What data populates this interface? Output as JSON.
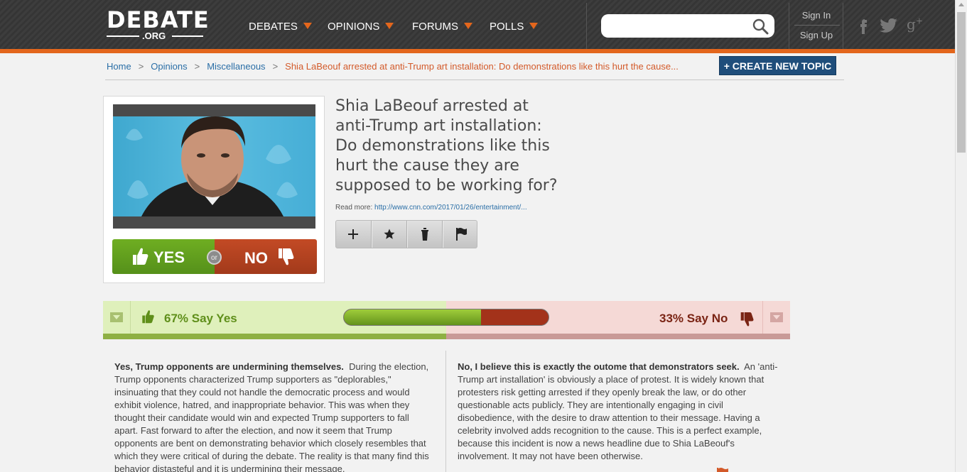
{
  "header": {
    "logo_main": "DEBATE",
    "logo_sub": ".ORG",
    "nav": [
      {
        "label": "DEBATES"
      },
      {
        "label": "OPINIONS"
      },
      {
        "label": "FORUMS"
      },
      {
        "label": "POLLS"
      }
    ],
    "search_placeholder": "",
    "sign_in": "Sign In",
    "sign_up": "Sign Up",
    "social": [
      "facebook-icon",
      "twitter-icon",
      "google-plus-icon"
    ],
    "accent_color": "#e3661c"
  },
  "breadcrumb": {
    "home": "Home",
    "opinions": "Opinions",
    "category": "Miscellaneous",
    "current": "Shia LaBeouf arrested at anti-Trump art installation: Do demonstrations like this hurt the cause..."
  },
  "create_topic_label": "+ CREATE NEW TOPIC",
  "topic": {
    "title": "Shia LaBeouf arrested at anti-Trump art installation: Do demonstrations like this hurt the cause they are supposed to be working for?",
    "read_more_label": "Read more:",
    "read_more_url": "http://www.cnn.com/2017/01/26/entertainment/...",
    "vote_yes": "YES",
    "vote_or": "or",
    "vote_no": "NO",
    "actions": [
      "plus-icon",
      "star-icon",
      "trash-icon",
      "flag-icon"
    ]
  },
  "poll": {
    "yes_label": "67% Say Yes",
    "no_label": "33% Say No",
    "yes_fraction": 0.67
  },
  "arguments": {
    "yes": {
      "headline": "Yes, Trump opponents are undermining themselves.",
      "body": "During the election, Trump opponents characterized Trump supporters as \"deplorables,\" insinuating that they could not handle the democratic process and would exhibit violence, hatred, and inappropriate behavior. This was when they thought their candidate would win and expected Trump supporters to fall apart. Fast forward to after the election, and now it seem that Trump opponents are bent on demonstrating behavior which closely resembles that which they were critical of during the debate. The reality is that many find this behavior distasteful and it is undermining their message."
    },
    "no": {
      "headline": "No, I believe this is exactly the outome that demonstrators seek.",
      "body": "An 'anti-Trump art installation' is obviously a place of protest. It is widely known that protesters risk getting arrested if they openly break the law, or do other questionable acts publicly. They are intentionally engaging in civil disobedience, with the desire to draw attention to their message. Having a celebrity involved adds recognition to the cause. This is a perfect example, because this incident is now a news headline due to Shia LaBeouf's involvement. It may not have been otherwise."
    }
  }
}
